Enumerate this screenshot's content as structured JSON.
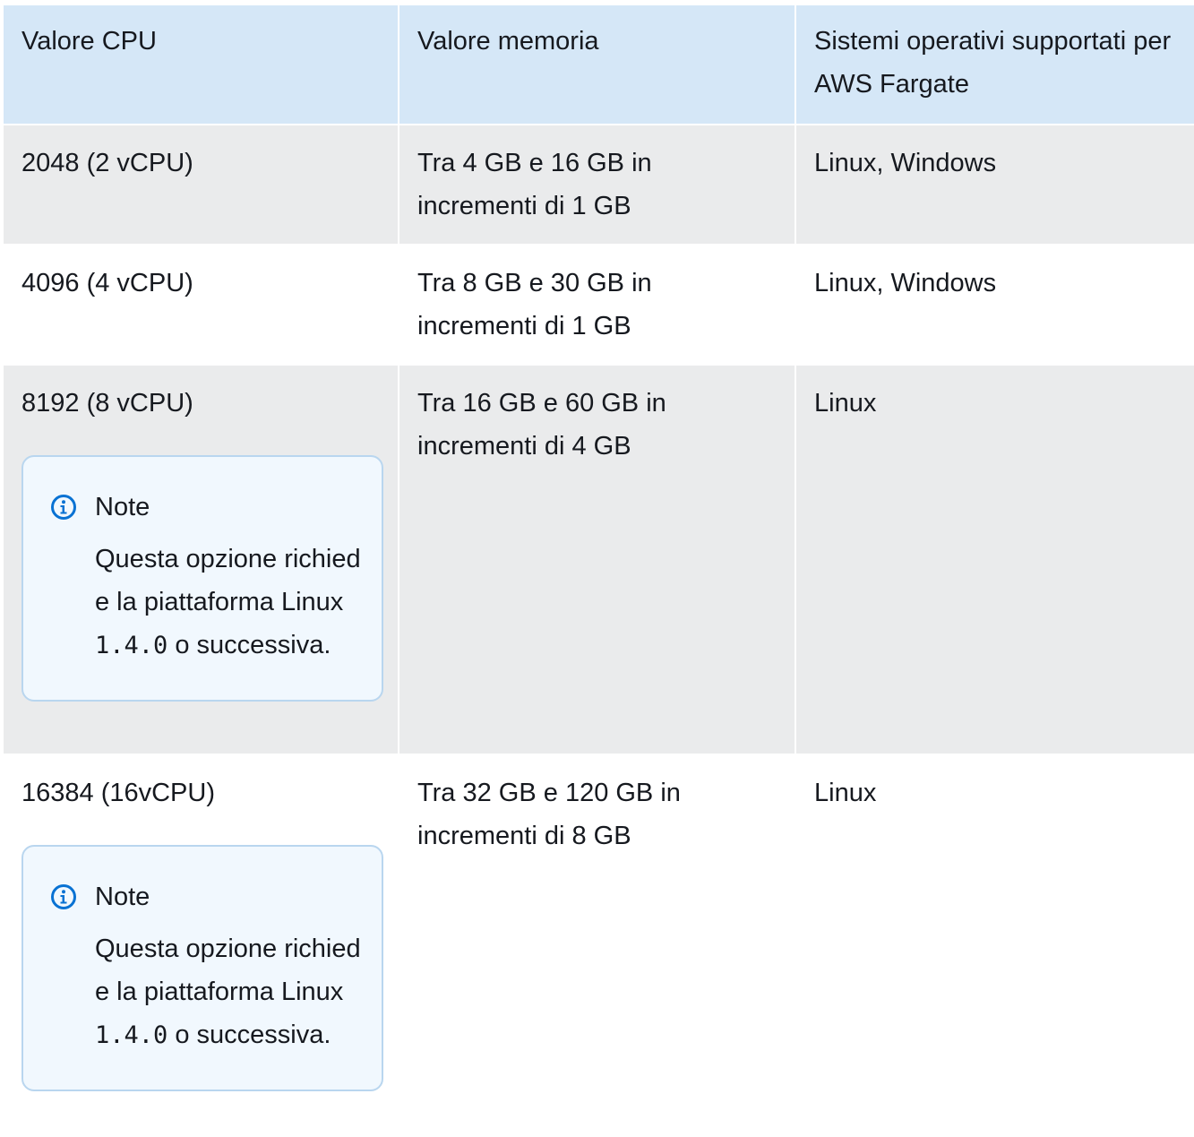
{
  "table": {
    "headers": [
      "Valore CPU",
      "Valore memoria",
      "Sistemi operativi supportati per AWS Fargate"
    ],
    "rows": [
      {
        "cpu": "2048 (2 vCPU)",
        "memory": "Tra 4 GB e 16 GB in incrementi di 1 GB",
        "os": "Linux, Windows"
      },
      {
        "cpu": "4096 (4 vCPU)",
        "memory": "Tra 8 GB e 30 GB in incrementi di 1 GB",
        "os": "Linux, Windows"
      },
      {
        "cpu": "8192 (8 vCPU)",
        "memory": "Tra 16 GB e 60 GB in incrementi di 4 GB",
        "os": "Linux",
        "note": {
          "title": "Note",
          "text_before": "Questa opzione richiede la piattaforma Linux ",
          "code": "1.4.0",
          "text_after": " o successiva."
        }
      },
      {
        "cpu": "16384 (16vCPU)",
        "memory": "Tra 32 GB e 120 GB in incrementi di 8 GB",
        "os": "Linux",
        "note": {
          "title": "Note",
          "text_before": "Questa opzione richiede la piattaforma Linux ",
          "code": "1.4.0",
          "text_after": " o successiva."
        }
      }
    ]
  },
  "colors": {
    "header_bg": "#d5e7f7",
    "row_alt_bg": "#eaebec",
    "note_bg": "#f1f8fe",
    "note_border": "#b9d6ef",
    "info_icon": "#0972d3"
  },
  "icons": {
    "note_icon": "info-circle-icon"
  }
}
